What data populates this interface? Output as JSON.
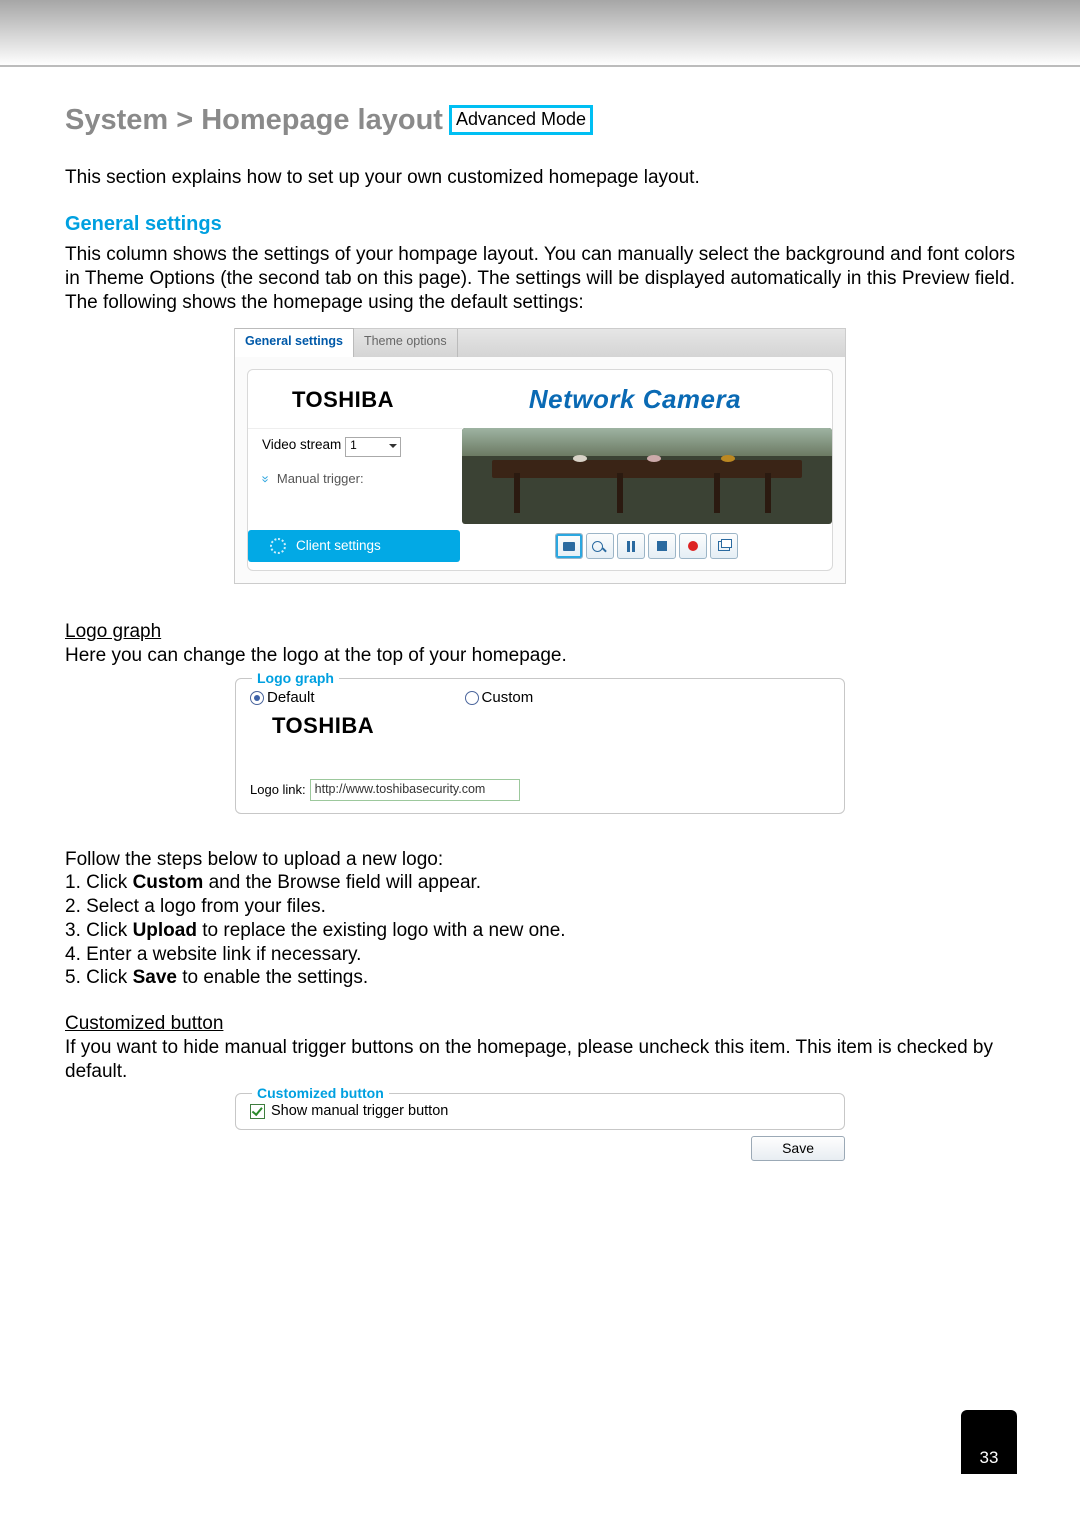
{
  "heading": {
    "title": "System > Homepage layout",
    "mode_badge": "Advanced Mode"
  },
  "intro": "This section explains how to set up your own customized homepage layout.",
  "general": {
    "title": "General settings",
    "paragraph": "This column shows the settings of your hompage layout. You can manually select the background and font colors in Theme Options (the second tab on this page). The settings will be displayed automatically in this Preview field. The following shows the homepage using the default settings:"
  },
  "preview": {
    "tabs": {
      "active": "General settings",
      "inactive": "Theme options"
    },
    "brand": "TOSHIBA",
    "product": "Network Camera",
    "video_stream_label": "Video stream",
    "video_stream_value": "1",
    "manual_trigger_label": "Manual trigger:",
    "client_settings_label": "Client settings",
    "icons": [
      "camera-icon",
      "magnify-icon",
      "pause-icon",
      "stop-icon",
      "record-icon",
      "fullscreen-icon"
    ]
  },
  "logo_graph": {
    "heading": "Logo graph",
    "intro": "Here you can change the logo at the top of your homepage.",
    "legend": "Logo graph",
    "option_default": "Default",
    "option_custom": "Custom",
    "brand": "TOSHIBA",
    "link_label": "Logo link:",
    "link_value": "http://www.toshibasecurity.com"
  },
  "steps": {
    "intro": "Follow the steps below to upload a new logo:",
    "s1a": "1. Click ",
    "s1b": "Custom",
    "s1c": " and the Browse field will appear.",
    "s2": "2. Select a logo from your files.",
    "s3a": "3. Click ",
    "s3b": "Upload",
    "s3c": " to replace the existing logo with a new one.",
    "s4": "4. Enter a website link if necessary.",
    "s5a": "5. Click ",
    "s5b": "Save",
    "s5c": " to enable the settings."
  },
  "custom_button": {
    "heading": "Customized button",
    "paragraph": "If you want to hide manual trigger buttons on the homepage, please uncheck this item. This item is checked by default.",
    "legend": "Customized button",
    "checkbox_label": "Show manual trigger button",
    "save": "Save"
  },
  "page_number": "33"
}
